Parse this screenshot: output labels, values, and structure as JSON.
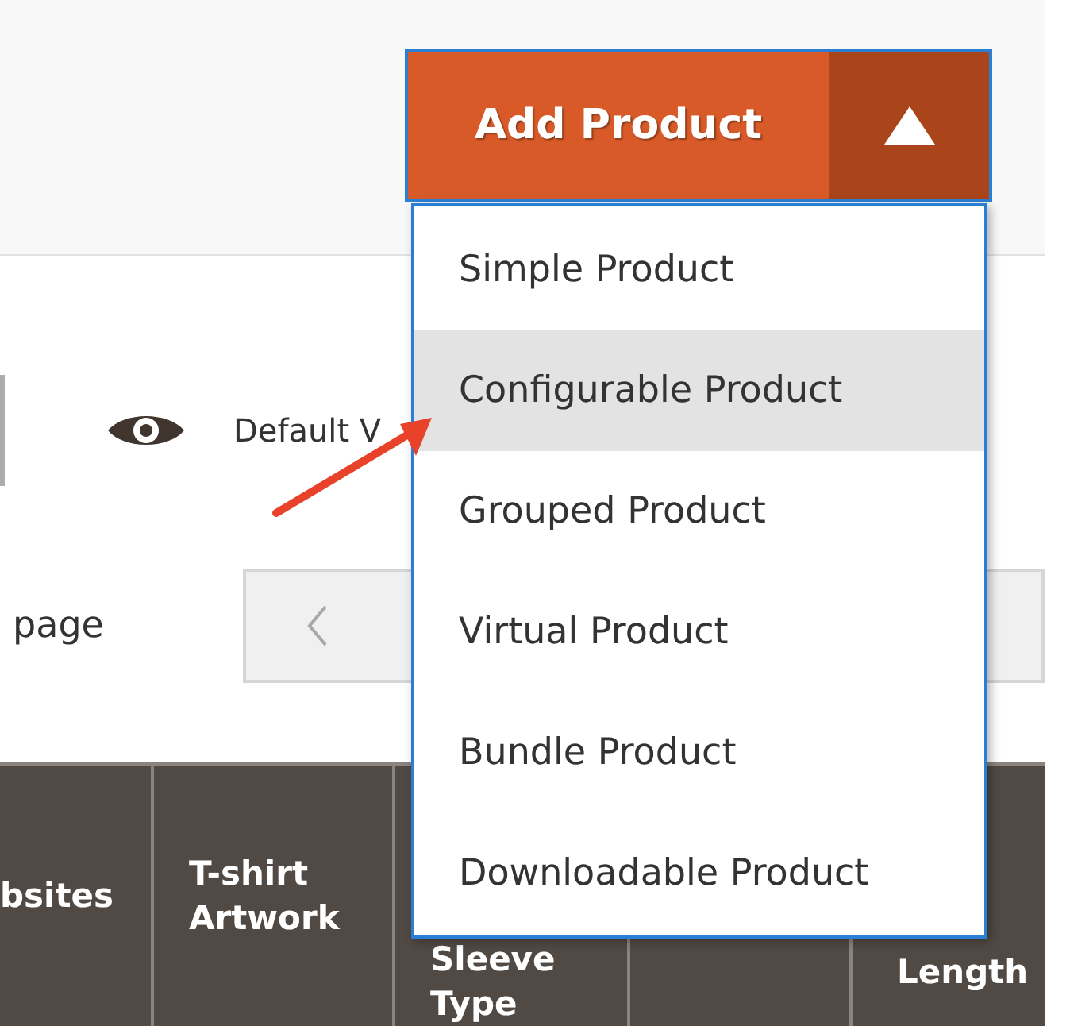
{
  "header": {
    "add_button": {
      "label": "Add Product",
      "expanded": true
    },
    "menu": [
      {
        "label": "Simple Product",
        "selected": false
      },
      {
        "label": "Configurable Product",
        "selected": true
      },
      {
        "label": "Grouped Product",
        "selected": false
      },
      {
        "label": "Virtual Product",
        "selected": false
      },
      {
        "label": "Bundle Product",
        "selected": false
      },
      {
        "label": "Downloadable Product",
        "selected": false
      }
    ]
  },
  "toolbar": {
    "view_label": "Default V",
    "pager_label": "page"
  },
  "table": {
    "columns": [
      {
        "label": "bsites"
      },
      {
        "label": "T-shirt Artwork"
      },
      {
        "label": "Sleeve Type"
      },
      {},
      {
        "label": "Length"
      }
    ]
  }
}
